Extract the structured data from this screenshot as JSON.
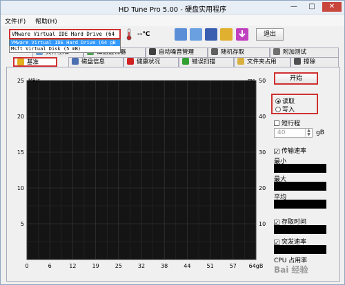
{
  "window": {
    "title": "HD Tune Pro 5.00 - 硬盘实用程序",
    "minimize": "—",
    "maximize": "□",
    "close": "✕"
  },
  "menu": [
    "文件(F)",
    "帮助(H)"
  ],
  "drive": {
    "selected": "VMware Virtual IDE Hard Drive (64",
    "options": [
      {
        "label": "VMware Virtual IDE Hard Drive (64 gB",
        "selected": true
      },
      {
        "label": "Msft    Virtual Disk    (5 mB)",
        "selected": false
      }
    ]
  },
  "temperature": "--℃",
  "exit_label": "退出",
  "tabs_top": [
    "文件基准",
    "磁盘监视器",
    "自动噪音管理",
    "随机存取",
    "附加测试"
  ],
  "tabs_bottom": [
    {
      "label": "基准",
      "active": true
    },
    {
      "label": "磁盘信息",
      "active": false
    },
    {
      "label": "健康状况",
      "active": false
    },
    {
      "label": "错误扫描",
      "active": false
    },
    {
      "label": "文件夹占用",
      "active": false
    },
    {
      "label": "擦除",
      "active": false
    }
  ],
  "start_label": "开始",
  "mode": {
    "read": "读取",
    "write": "写入",
    "selected": "read"
  },
  "short_stroke": {
    "label": "短行程",
    "checked": false,
    "value": "40",
    "unit": "gB"
  },
  "transfer_rate": {
    "label": "传输速率",
    "checked": true
  },
  "stats": {
    "min": "最小",
    "max": "最大",
    "avg": "平均"
  },
  "access_time": {
    "label": "存取时间",
    "checked": true
  },
  "burst_rate": {
    "label": "突发速率",
    "checked": true
  },
  "cpu_label": "CPU 占用率",
  "watermark": "Bai 经验",
  "chart_data": {
    "type": "line",
    "y_left_label": "MB/s",
    "y_right_label": "ms",
    "y_left_ticks": [
      "25",
      "20",
      "15",
      "10",
      "5"
    ],
    "y_right_ticks": [
      "50",
      "40",
      "30",
      "20",
      "10"
    ],
    "x_ticks": [
      "0",
      "6",
      "12",
      "19",
      "25",
      "32",
      "38",
      "44",
      "51",
      "57",
      "64gB"
    ],
    "ylim_left": [
      0,
      25
    ],
    "ylim_right": [
      0,
      50
    ],
    "grid": true,
    "series": []
  }
}
